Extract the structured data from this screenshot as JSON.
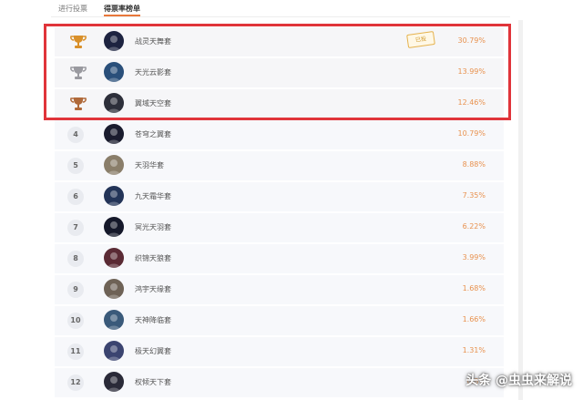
{
  "tabs": [
    {
      "label": "进行投票"
    },
    {
      "label": "得票率榜单"
    }
  ],
  "rows": [
    {
      "rank": "",
      "name": "战灵天舞套",
      "pct": "30.79%",
      "trophy": "gold",
      "badge": "已投"
    },
    {
      "rank": "",
      "name": "天光云影套",
      "pct": "13.99%",
      "trophy": "silver"
    },
    {
      "rank": "",
      "name": "翼域天空套",
      "pct": "12.46%",
      "trophy": "bronze"
    },
    {
      "rank": "4",
      "name": "苍穹之翼套",
      "pct": "10.79%"
    },
    {
      "rank": "5",
      "name": "天羽华套",
      "pct": "8.88%"
    },
    {
      "rank": "6",
      "name": "九天霜华套",
      "pct": "7.35%"
    },
    {
      "rank": "7",
      "name": "冥光天羽套",
      "pct": "6.22%"
    },
    {
      "rank": "8",
      "name": "织锦天狼套",
      "pct": "3.99%"
    },
    {
      "rank": "9",
      "name": "鸿宇天缘套",
      "pct": "1.68%"
    },
    {
      "rank": "10",
      "name": "天神降临套",
      "pct": "1.66%"
    },
    {
      "rank": "11",
      "name": "极天幻翼套",
      "pct": "1.31%"
    },
    {
      "rank": "12",
      "name": "权倾天下套",
      "pct": "0.8%"
    }
  ],
  "colors": {
    "accent": "#e8773a",
    "percent": "#e8924f",
    "highlight": "#e0343a",
    "gold": "#d9902a",
    "silver": "#9a9aa0",
    "bronze": "#b06a3a"
  },
  "watermark": "头条 @虫虫来解说"
}
